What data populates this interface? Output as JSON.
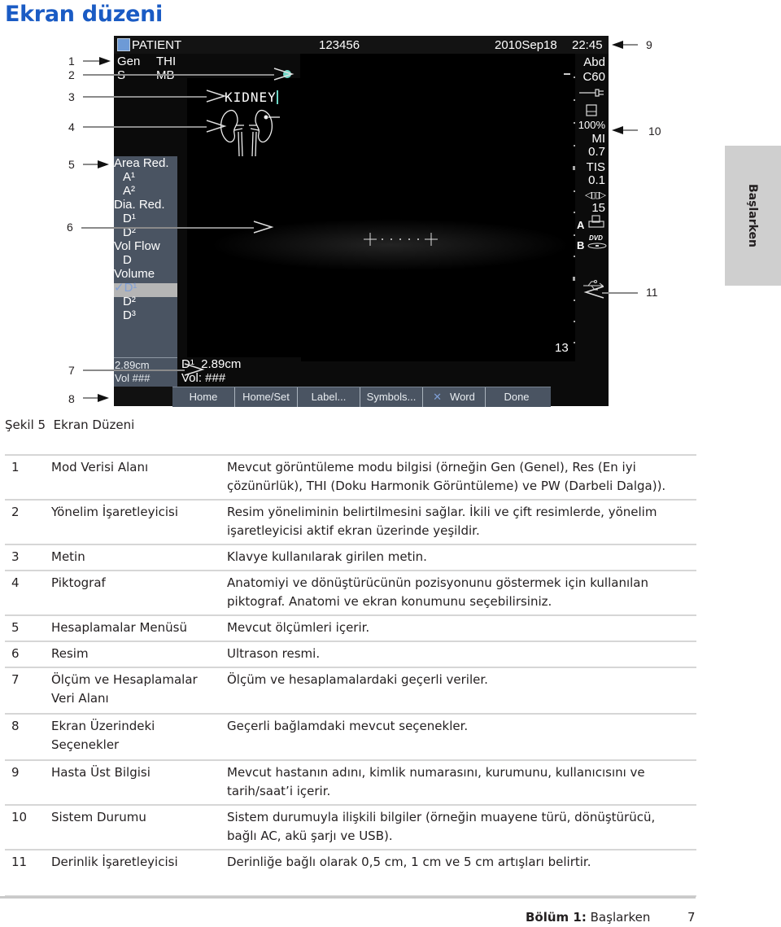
{
  "page": {
    "title": "Ekran düzeni",
    "side_tab": "Başlarken",
    "caption": "Şekil 5  Ekran Düzeni",
    "footer": {
      "chapter": "Bölüm 1:",
      "chapter_title": "Başlarken",
      "page_number": "7"
    }
  },
  "screen": {
    "header": {
      "patient": "PATIENT",
      "id": "123456",
      "date": "2010Sep18",
      "time": "22:45"
    },
    "mode": {
      "line1_a": "Gen",
      "line1_b": "THI",
      "line2_a": "S",
      "line2_b": "MB"
    },
    "text_annotation": "KIDNEY",
    "orientation_marker_color": "#6fd8c8",
    "calcs_menu": [
      {
        "label": "Area Red.",
        "sub": false
      },
      {
        "label": "A¹",
        "sub": true
      },
      {
        "label": "A²",
        "sub": true
      },
      {
        "label": "Dia. Red.",
        "sub": false
      },
      {
        "label": "D¹",
        "sub": true
      },
      {
        "label": "D²",
        "sub": true
      },
      {
        "label": "Vol Flow",
        "sub": false
      },
      {
        "label": "D",
        "sub": true
      },
      {
        "label": "Volume",
        "sub": false
      },
      {
        "label": "✓D¹",
        "sub": false,
        "selected": true
      },
      {
        "label": "D²",
        "sub": true
      },
      {
        "label": "D³",
        "sub": true
      }
    ],
    "status": {
      "exam": "Abd",
      "transducer": "C60",
      "battery": "100%",
      "mi_label": "MI",
      "mi_value": "0.7",
      "tis_label": "TIS",
      "tis_value": "0.1",
      "gain_value": "15",
      "printer_label": "A",
      "dvd_label": "B",
      "dvd_text": "DVD"
    },
    "depth": "13",
    "measure": {
      "left_line1": "2.89cm",
      "left_line2": "Vol ###",
      "main_line1": "D¹  2.89cm",
      "main_line2": "Vol: ###"
    },
    "softkeys": [
      "Home",
      "Home/Set",
      "Label...",
      "Symbols...",
      "Word",
      "Done"
    ],
    "callouts": [
      "1",
      "2",
      "3",
      "4",
      "5",
      "6",
      "7",
      "8",
      "9",
      "10",
      "11"
    ]
  },
  "table": [
    {
      "num": "1",
      "name": "Mod Verisi Alanı",
      "desc": "Mevcut görüntüleme modu bilgisi (örneğin Gen (Genel), Res (En iyi çözünürlük), THI (Doku Harmonik Görüntüleme) ve PW (Darbeli Dalga))."
    },
    {
      "num": "2",
      "name": "Yönelim İşaretleyicisi",
      "desc": "Resim yöneliminin belirtilmesini sağlar. İkili ve çift resimlerde, yönelim işaretleyicisi aktif ekran üzerinde yeşildir."
    },
    {
      "num": "3",
      "name": "Metin",
      "desc": "Klavye kullanılarak girilen metin."
    },
    {
      "num": "4",
      "name": "Piktograf",
      "desc": "Anatomiyi ve dönüştürücünün pozisyonunu göstermek için kullanılan piktograf. Anatomi ve ekran konumunu seçebilirsiniz."
    },
    {
      "num": "5",
      "name": "Hesaplamalar Menüsü",
      "desc": "Mevcut ölçümleri içerir."
    },
    {
      "num": "6",
      "name": "Resim",
      "desc": "Ultrason resmi."
    },
    {
      "num": "7",
      "name": "Ölçüm ve Hesaplamalar Veri Alanı",
      "desc": "Ölçüm ve hesaplamalardaki geçerli veriler."
    },
    {
      "num": "8",
      "name": "Ekran Üzerindeki Seçenekler",
      "desc": "Geçerli bağlamdaki mevcut seçenekler."
    },
    {
      "num": "9",
      "name": "Hasta Üst Bilgisi",
      "desc": "Mevcut hastanın adını, kimlik numarasını, kurumunu, kullanıcısını ve tarih/saat’i içerir."
    },
    {
      "num": "10",
      "name": "Sistem Durumu",
      "desc": "Sistem durumuyla ilişkili bilgiler (örneğin muayene türü, dönüştürücü, bağlı AC, akü şarjı ve USB)."
    },
    {
      "num": "11",
      "name": "Derinlik İşaretleyicisi",
      "desc": "Derinliğe bağlı olarak 0,5 cm, 1 cm ve 5 cm artışları belirtir."
    }
  ]
}
